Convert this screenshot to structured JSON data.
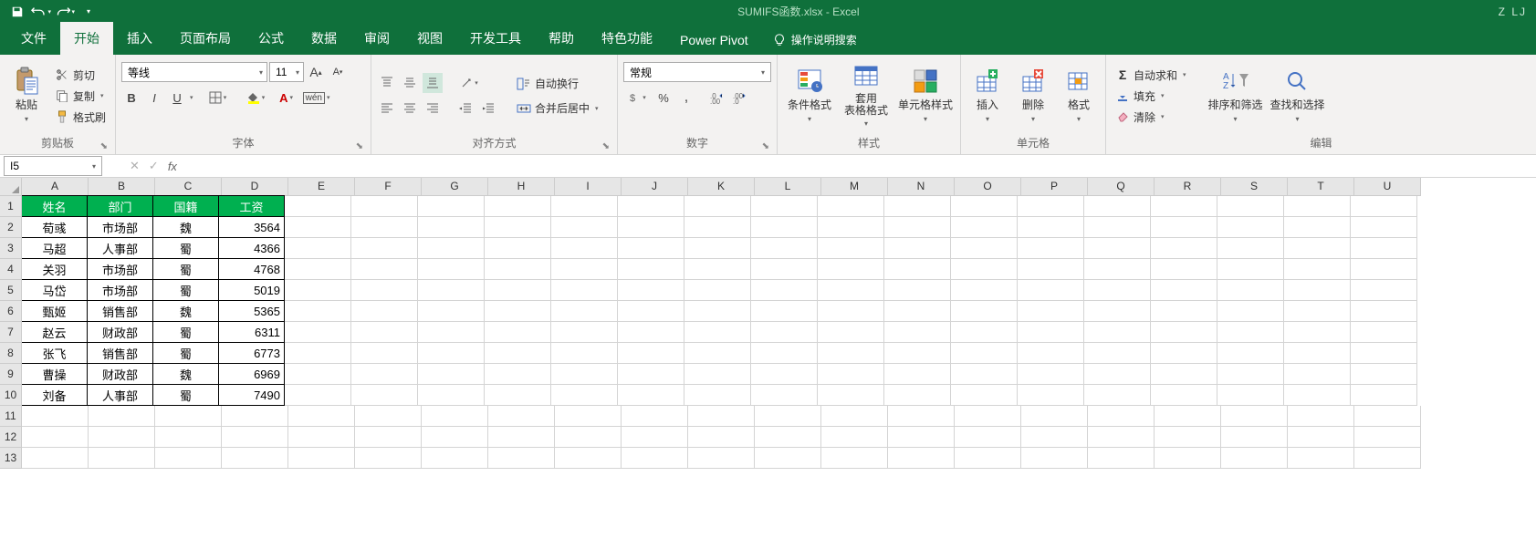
{
  "title": "SUMIFS函数.xlsx  -  Excel",
  "user_badge": "Z LJ",
  "tabs": {
    "file": "文件",
    "home": "开始",
    "insert": "插入",
    "page_layout": "页面布局",
    "formulas": "公式",
    "data": "数据",
    "review": "审阅",
    "view": "视图",
    "developer": "开发工具",
    "help": "帮助",
    "special": "特色功能",
    "power_pivot": "Power Pivot",
    "tell_me": "操作说明搜索"
  },
  "ribbon": {
    "clipboard": {
      "paste": "粘贴",
      "cut": "剪切",
      "copy": "复制",
      "format_painter": "格式刷",
      "label": "剪贴板"
    },
    "font": {
      "name": "等线",
      "size": "11",
      "label": "字体"
    },
    "alignment": {
      "wrap": "自动换行",
      "merge": "合并后居中",
      "label": "对齐方式"
    },
    "number": {
      "format": "常规",
      "label": "数字"
    },
    "styles": {
      "cond": "条件格式",
      "table": "套用\n表格格式",
      "cell": "单元格样式",
      "label": "样式"
    },
    "cells": {
      "insert": "插入",
      "delete": "删除",
      "format": "格式",
      "label": "单元格"
    },
    "editing": {
      "sum": "自动求和",
      "fill": "填充",
      "clear": "清除",
      "sort": "排序和筛选",
      "find": "查找和选择",
      "label": "编辑"
    }
  },
  "namebox": "I5",
  "columns": [
    "A",
    "B",
    "C",
    "D",
    "E",
    "F",
    "G",
    "H",
    "I",
    "J",
    "K",
    "L",
    "M",
    "N",
    "O",
    "P",
    "Q",
    "R",
    "S",
    "T",
    "U"
  ],
  "row_numbers": [
    1,
    2,
    3,
    4,
    5,
    6,
    7,
    8,
    9,
    10,
    11,
    12,
    13
  ],
  "table": {
    "headers": [
      "姓名",
      "部门",
      "国籍",
      "工资"
    ],
    "rows": [
      [
        "荀彧",
        "市场部",
        "魏",
        "3564"
      ],
      [
        "马超",
        "人事部",
        "蜀",
        "4366"
      ],
      [
        "关羽",
        "市场部",
        "蜀",
        "4768"
      ],
      [
        "马岱",
        "市场部",
        "蜀",
        "5019"
      ],
      [
        "甄姬",
        "销售部",
        "魏",
        "5365"
      ],
      [
        "赵云",
        "财政部",
        "蜀",
        "6311"
      ],
      [
        "张飞",
        "销售部",
        "蜀",
        "6773"
      ],
      [
        "曹操",
        "财政部",
        "魏",
        "6969"
      ],
      [
        "刘备",
        "人事部",
        "蜀",
        "7490"
      ]
    ]
  }
}
